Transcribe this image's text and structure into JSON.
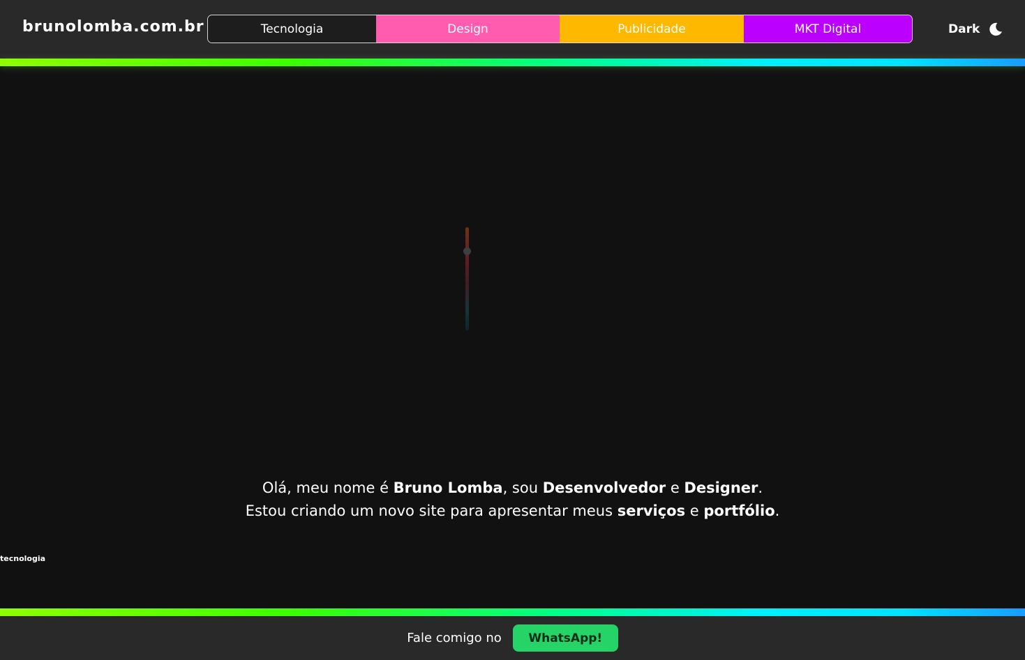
{
  "header": {
    "logo": "brunolomba.com.br",
    "tabs": [
      {
        "label": "Tecnologia",
        "color": "#1d1d1e"
      },
      {
        "label": "Design",
        "color": "#ff5cb0"
      },
      {
        "label": "Publicidade",
        "color": "#ffb800"
      },
      {
        "label": "MKT Digital",
        "color": "#bb00ff"
      }
    ],
    "theme_toggle": {
      "label": "Dark",
      "icon": "moon-icon"
    }
  },
  "main": {
    "intro_line1": {
      "t1": "Olá, meu nome é ",
      "b1": "Bruno Lomba",
      "t2": ", sou ",
      "b2": "Desenvolvedor",
      "t3": " e ",
      "b3": "Designer",
      "t4": "."
    },
    "intro_line2": {
      "t1": "Estou criando um novo site para apresentar meus ",
      "b1": "serviços",
      "t2": " e ",
      "b2": "portfólio",
      "t3": "."
    },
    "side_label": "tecnologia"
  },
  "footer": {
    "text": "Fale comigo no",
    "button_label": "WhatsApp!",
    "button_color": "#25d366"
  },
  "colors": {
    "background": "#111112",
    "header_background": "#29292a",
    "accent_gradient": [
      "#90ff00",
      "#3cff00",
      "#00ff8c",
      "#00f0ff",
      "#1a9cff"
    ]
  }
}
